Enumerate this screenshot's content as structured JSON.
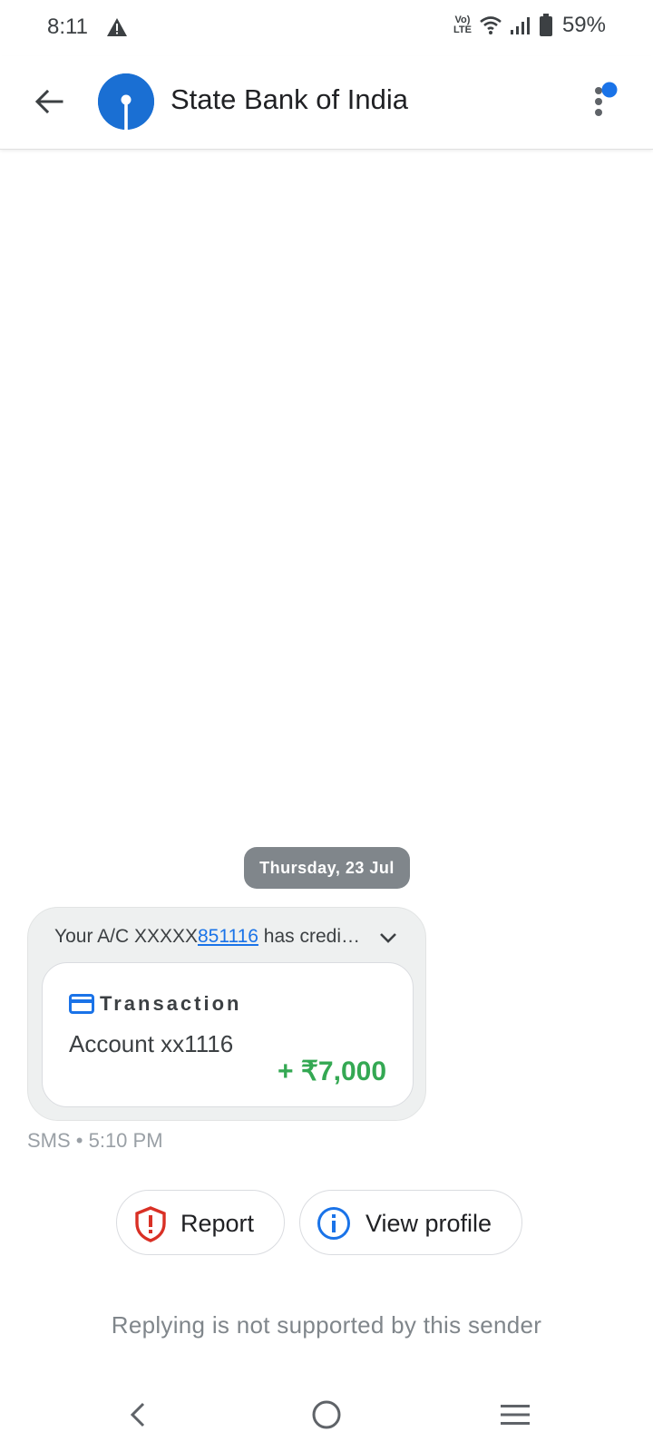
{
  "status_bar": {
    "time": "8:11",
    "volte_top": "Vo)",
    "volte_bottom": "LTE",
    "battery": "59%"
  },
  "app_bar": {
    "sender_name": "State Bank of India"
  },
  "conversation": {
    "date_chip": "Thursday, 23 Jul",
    "message": {
      "preview_prefix": "Your A/C XXXXX",
      "account_link": "851116",
      "preview_suffix": " has credi…",
      "card": {
        "title": "Transaction",
        "account": "Account xx1116",
        "amount": "+ ₹7,000"
      },
      "meta": "SMS • 5:10 PM"
    }
  },
  "actions": {
    "report_label": "Report",
    "view_profile_label": "View profile"
  },
  "reply_note": "Replying is not supported by this sender",
  "colors": {
    "accent": "#1a73e8",
    "avatar": "#1a6fd3",
    "amount_green": "#34a853",
    "report_red": "#d93025",
    "chip_gray": "#80868b"
  },
  "icons": [
    "warning-icon",
    "wifi-icon",
    "signal-icon",
    "battery-icon",
    "back-arrow-icon",
    "sbi-logo",
    "more-vert-icon",
    "chevron-down-icon",
    "card-icon",
    "shield-alert-icon",
    "info-icon",
    "nav-back-icon",
    "nav-home-icon",
    "nav-recents-icon"
  ]
}
